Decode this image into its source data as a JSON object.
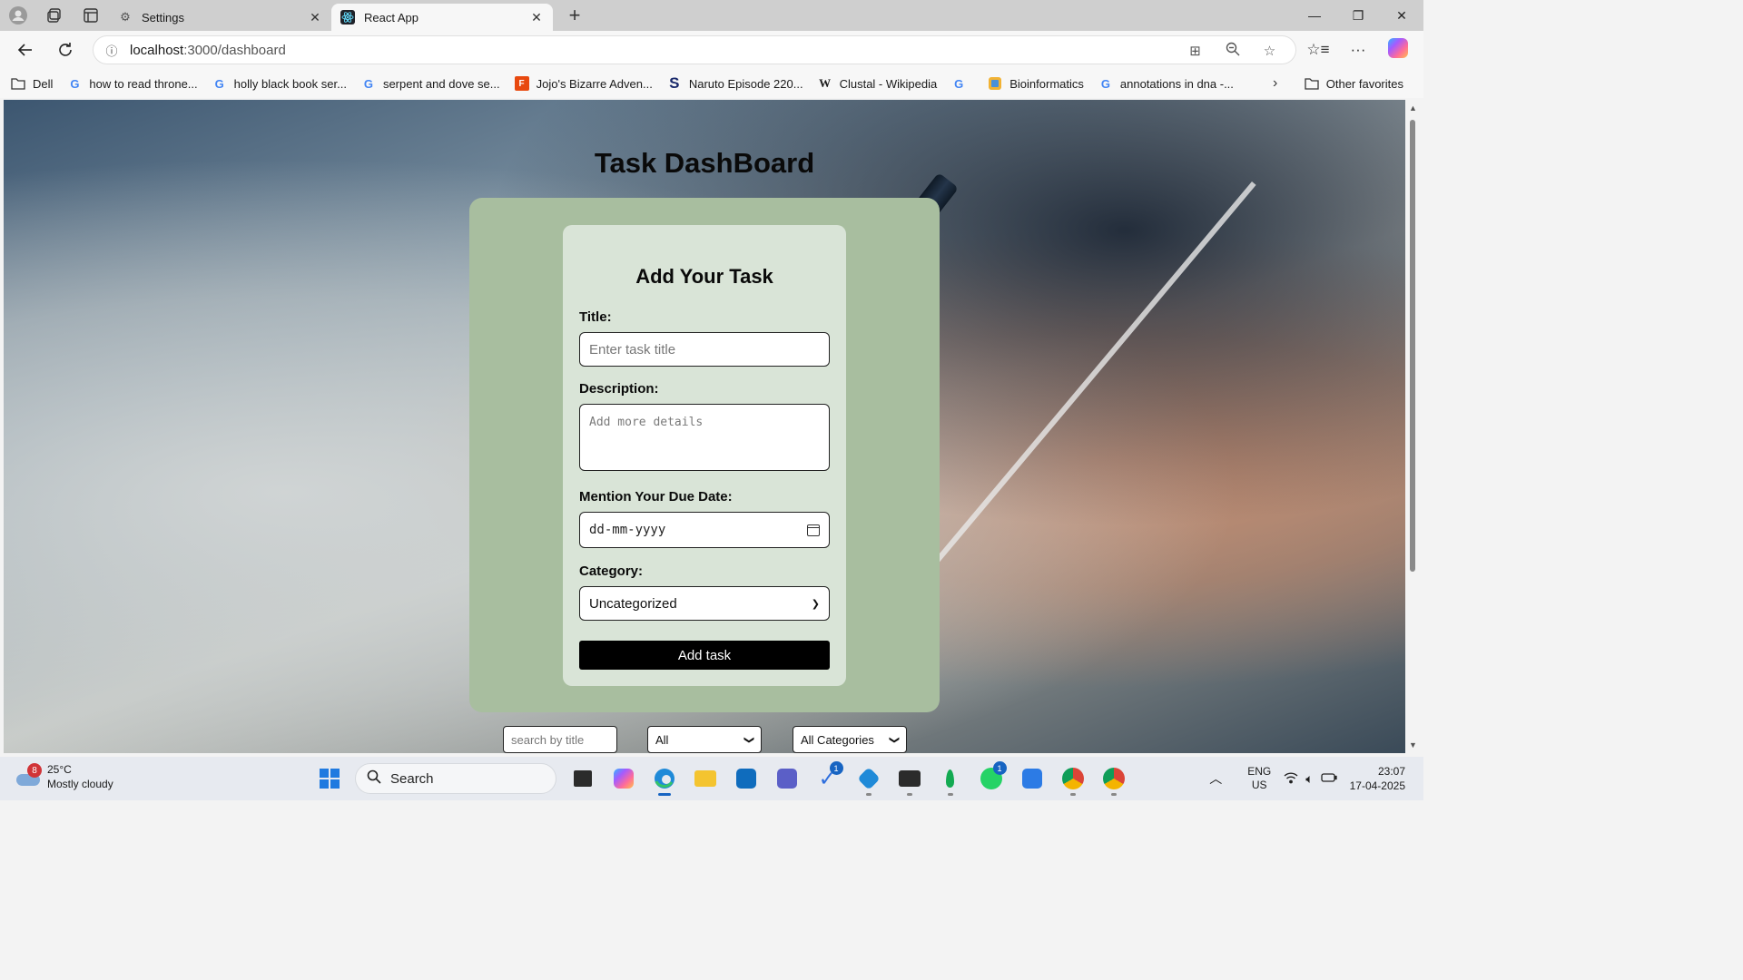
{
  "browser": {
    "tabs": [
      {
        "title": "Settings",
        "icon": "gear-icon",
        "active": false
      },
      {
        "title": "React App",
        "icon": "react-icon",
        "active": true
      }
    ],
    "url_host": "localhost",
    "url_path": ":3000/dashboard",
    "favorites": [
      {
        "label": "Dell",
        "icon": "folder-icon"
      },
      {
        "label": "how to read throne...",
        "icon": "google-icon"
      },
      {
        "label": "holly black book ser...",
        "icon": "google-icon"
      },
      {
        "label": "serpent and dove se...",
        "icon": "google-icon"
      },
      {
        "label": "Jojo's Bizarre Adven...",
        "icon": "fandom-icon"
      },
      {
        "label": "Naruto Episode 220...",
        "icon": "s-icon"
      },
      {
        "label": "Clustal - Wikipedia",
        "icon": "wikipedia-icon"
      },
      {
        "label": "",
        "icon": "google-icon"
      },
      {
        "label": "Bioinformatics",
        "icon": "bookmark-icon"
      },
      {
        "label": "annotations in dna -...",
        "icon": "google-icon"
      }
    ],
    "other_favorites": "Other favorites"
  },
  "page": {
    "title": "Task DashBoard",
    "form": {
      "heading": "Add Your Task",
      "title_label": "Title:",
      "title_placeholder": "Enter task title",
      "description_label": "Description:",
      "description_placeholder": "Add more details",
      "due_label": "Mention Your Due Date:",
      "due_placeholder": "dd-mm-yyyy",
      "category_label": "Category:",
      "category_value": "Uncategorized",
      "submit": "Add task"
    },
    "filters": {
      "search_placeholder": "search by title",
      "status_value": "All",
      "category_value": "All Categories"
    }
  },
  "taskbar": {
    "weather_temp": "25°C",
    "weather_desc": "Mostly cloudy",
    "weather_badge": "8",
    "search_label": "Search",
    "lang_1": "ENG",
    "lang_2": "US",
    "time": "23:07",
    "date": "17-04-2025",
    "badges": {
      "todo": "1",
      "whatsapp": "1"
    }
  },
  "colors": {
    "outer_card": "#a8be9f",
    "inner_card": "#d9e4d7",
    "button": "#000000"
  }
}
